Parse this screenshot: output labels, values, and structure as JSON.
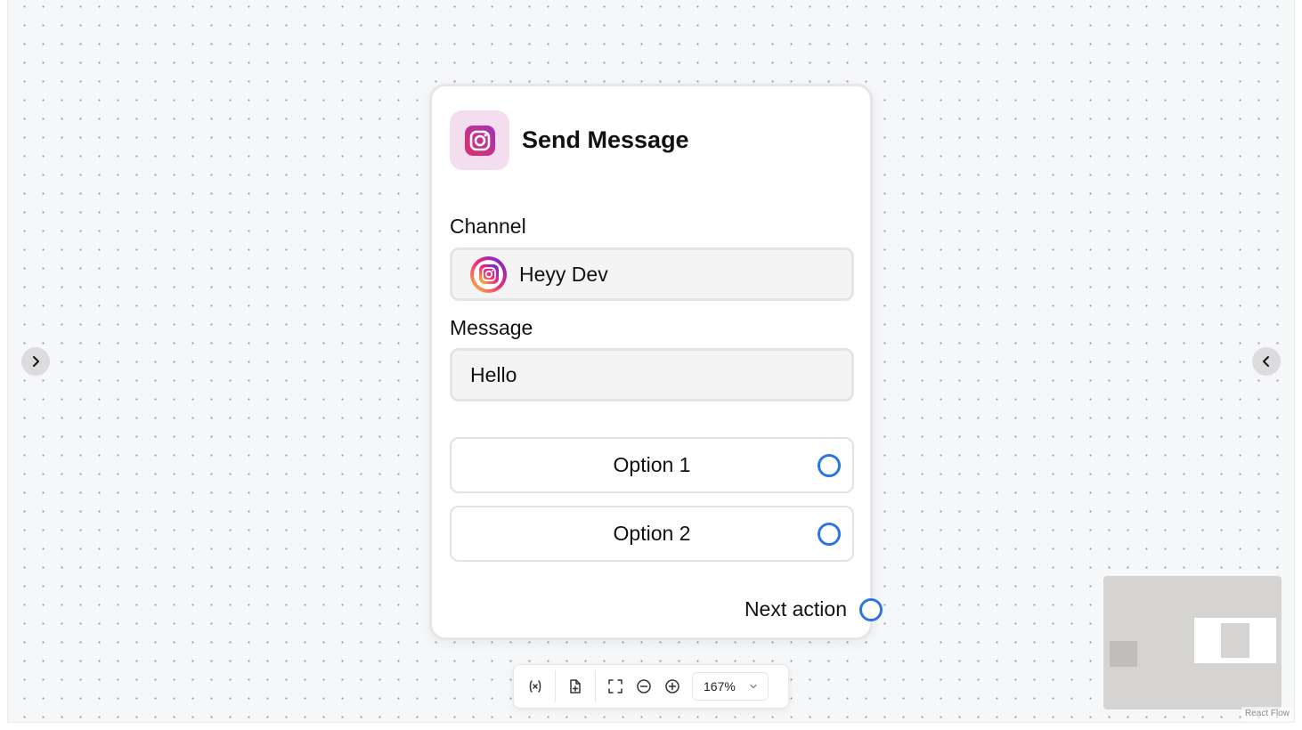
{
  "node": {
    "title": "Send Message",
    "channel_label": "Channel",
    "channel_value": "Heyy Dev",
    "message_label": "Message",
    "message_value": "Hello",
    "options": [
      {
        "label": "Option 1"
      },
      {
        "label": "Option 2"
      }
    ],
    "next_action_label": "Next action",
    "icon": "instagram-icon"
  },
  "toolbar": {
    "buttons": [
      "variable-icon",
      "add-file-icon",
      "fit-view-icon",
      "zoom-out-icon",
      "zoom-in-icon"
    ],
    "zoom_level": "167%"
  },
  "attribution": "React Flow",
  "colors": {
    "handle": "#2c76e0",
    "icon_bg": "#f4ddef",
    "instagram": "#c13584",
    "canvas": "#f6f7f9"
  }
}
